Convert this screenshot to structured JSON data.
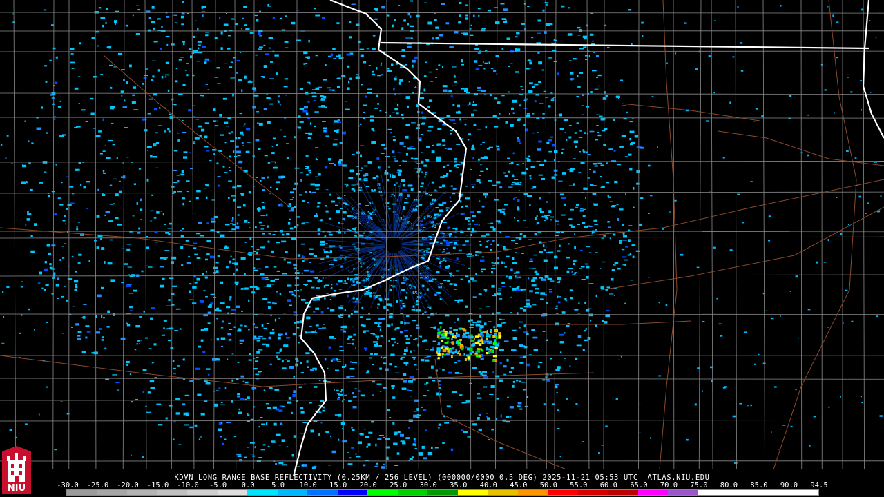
{
  "product": {
    "title": "KDVN LONG RANGE BASE REFLECTIVITY (0.25KM / 256 LEVEL) (000000/0000 0.5 DEG) 2025-11-21 05:53 UTC  ATLAS.NIU.EDU"
  },
  "scale": {
    "labels": [
      "-30.0",
      "-25.0",
      "-20.0",
      "-15.0",
      "-10.0",
      "-5.0",
      "0.0",
      "5.0",
      "10.0",
      "15.0",
      "20.0",
      "25.0",
      "30.0",
      "35.0",
      "40.0",
      "45.0",
      "50.0",
      "55.0",
      "60.0",
      "65.0",
      "70.0",
      "75.0",
      "80.0",
      "85.0",
      "90.0",
      "94.5"
    ],
    "colors": [
      "#9a9a9a",
      "#a6a6a6",
      "#b3b3b3",
      "#c0c0c0",
      "#cfcfcf",
      "#dedede",
      "#00e5ff",
      "#00b7ff",
      "#0072ff",
      "#0000ff",
      "#00ff00",
      "#00cf00",
      "#009a00",
      "#ffff00",
      "#e7c000",
      "#ff9600",
      "#ff0000",
      "#d40000",
      "#bc0000",
      "#ff00ff",
      "#9955c9",
      "#ffffff",
      "#ffffff",
      "#ffffff",
      "#ffffff"
    ]
  },
  "logo": {
    "text": "NIU",
    "name": "niu-logo"
  },
  "colors": {
    "background": "#000000",
    "county_lines": "#8a8a8a",
    "state_lines": "#ffffff",
    "highways": "#8b4a2b",
    "echo_primary": "#00c8ff",
    "echo_secondary": "#1e6bff"
  }
}
